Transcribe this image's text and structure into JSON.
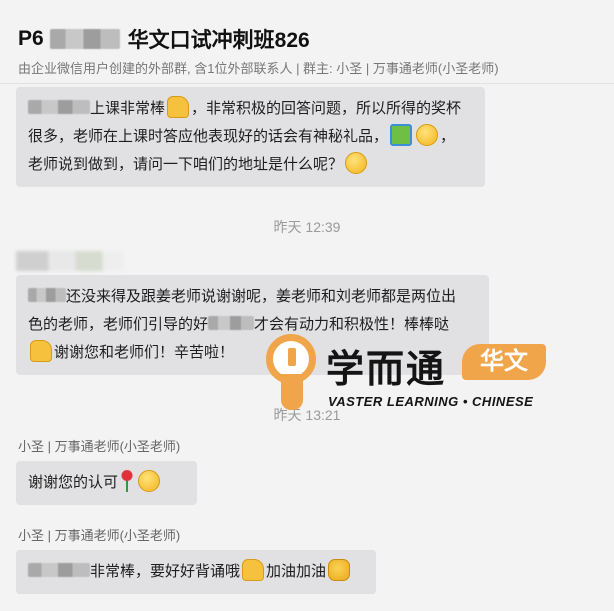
{
  "header": {
    "title_prefix": "P6",
    "title_suffix": "华文口试冲刺班826",
    "subtitle": "由企业微信用户创建的外部群, 含1位外部联系人 | 群主: 小圣 | 万事通老师(小圣老师)"
  },
  "messages": [
    {
      "lines": [
        "上课非常棒",
        "，非常积极的回答问题，所以所得的奖杯",
        "很多，老师在上课时答应他表现好的话会有神秘礼品，",
        "，",
        "老师说到做到，请问一下咱们的地址是什么呢？"
      ]
    },
    {
      "time": "昨天 12:39"
    },
    {
      "lines": [
        "还没来得及跟姜老师说谢谢呢，姜老师和刘老师都是两位出",
        "色的老师，老师们引导的好",
        "才会有动力和积极性！棒棒哒",
        "谢谢您和老师们！辛苦啦！"
      ]
    },
    {
      "time": "昨天 13:21"
    },
    {
      "sender": "小圣 | 万事通老师(小圣老师)",
      "text": "谢谢您的认可"
    },
    {
      "sender": "小圣 | 万事通老师(小圣老师)",
      "text_a": "非常棒，要好好背诵哦",
      "text_b": "加油加油"
    }
  ],
  "watermark": {
    "brand": "学而通",
    "badge": "华文",
    "sub": "VASTER LEARNING • CHINESE"
  }
}
